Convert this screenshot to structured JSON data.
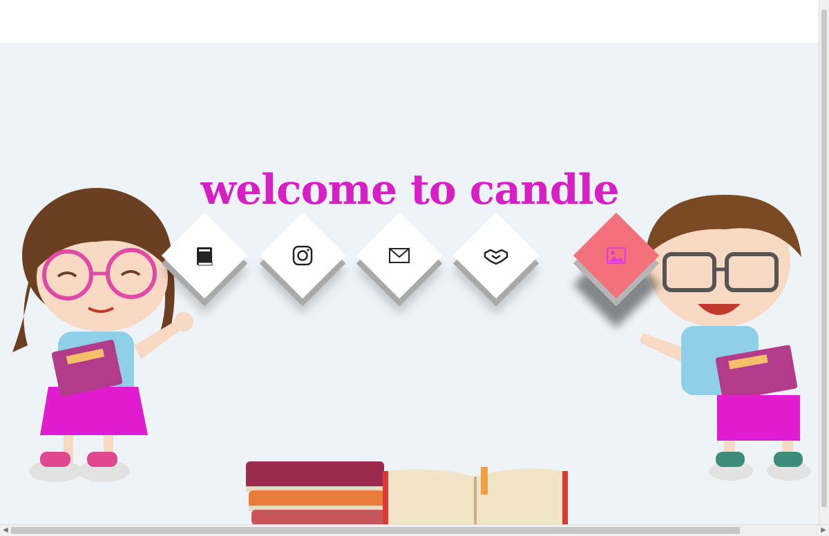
{
  "header": {
    "title": "welcome to candle"
  },
  "icons": [
    {
      "name": "book-icon"
    },
    {
      "name": "instagram-icon"
    },
    {
      "name": "mail-icon"
    },
    {
      "name": "handshake-icon"
    },
    {
      "name": "image-icon"
    }
  ],
  "colors": {
    "title": "#d81fc6",
    "background": "#eef3f8",
    "active_tile": "#f2717a",
    "tile": "#ffffff"
  }
}
